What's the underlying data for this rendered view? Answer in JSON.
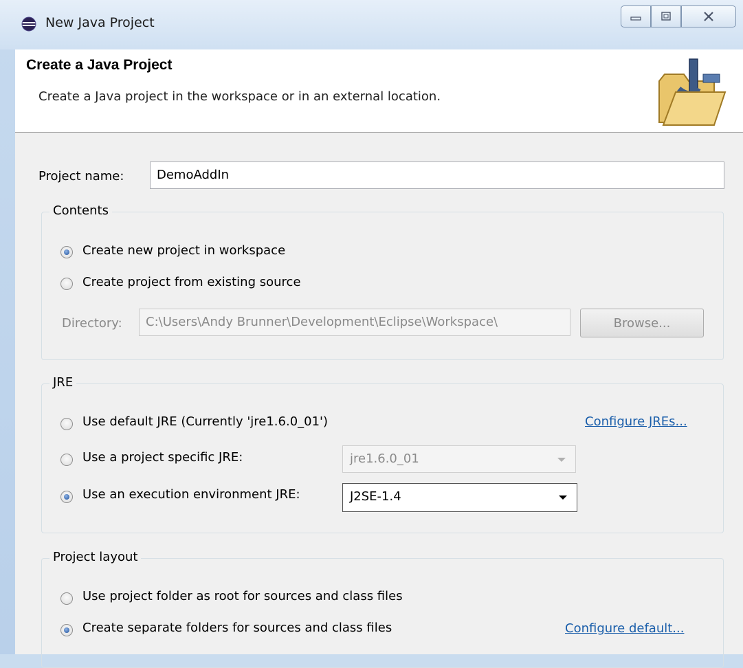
{
  "window": {
    "title": "New Java Project",
    "minimize_glyph": "–",
    "maximize_glyph": "□",
    "close_glyph": "✕"
  },
  "banner": {
    "title": "Create a Java Project",
    "description": "Create a Java project in the workspace or in an external location.",
    "icon": "java-folder-icon"
  },
  "project_name": {
    "label": "Project name:",
    "value": "DemoAddIn"
  },
  "contents": {
    "title": "Contents",
    "option_new": "Create new project in workspace",
    "option_existing": "Create project from existing source",
    "directory_label": "Directory:",
    "directory_value": "C:\\Users\\Andy Brunner\\Development\\Eclipse\\Workspace\\",
    "browse_label": "Browse...",
    "selected": "new"
  },
  "jre": {
    "title": "JRE",
    "option_default": "Use default JRE (Currently 'jre1.6.0_01')",
    "configure_link": "Configure JREs...",
    "option_specific": "Use a project specific JRE:",
    "specific_value": "jre1.6.0_01",
    "option_environment": "Use an execution environment JRE:",
    "environment_value": "J2SE-1.4",
    "selected": "environment"
  },
  "layout": {
    "title": "Project layout",
    "option_root": "Use project folder as root for sources and class files",
    "option_separate": "Create separate folders for sources and class files",
    "configure_link": "Configure default...",
    "selected": "separate"
  },
  "colors": {
    "link": "#1a5eaa",
    "window_frame": "#c9dcef"
  }
}
